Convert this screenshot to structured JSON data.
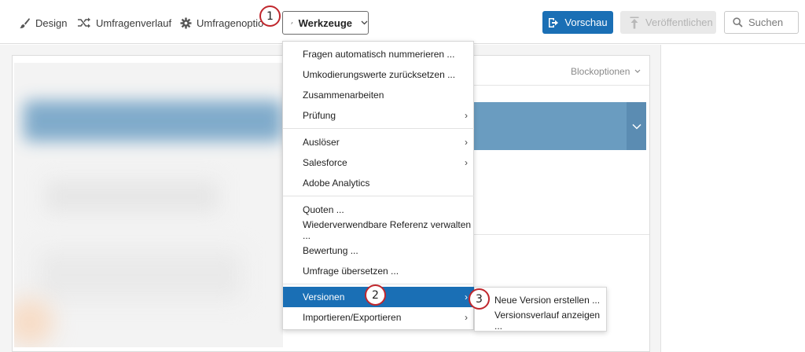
{
  "toolbar": {
    "nav": [
      {
        "label": "Design",
        "icon": "paintbrush-icon"
      },
      {
        "label": "Umfragenverlauf",
        "icon": "flow-icon"
      },
      {
        "label": "Umfragenoptio",
        "icon": "gear-icon"
      }
    ],
    "tools_label": "Werkzeuge",
    "preview_label": "Vorschau",
    "publish_label": "Veröffentlichen",
    "search_label": "Suchen"
  },
  "card": {
    "block_options_label": "Blockoptionen"
  },
  "menu": {
    "items": [
      {
        "label": "Fragen automatisch nummerieren ...",
        "submenu": false
      },
      {
        "label": "Umkodierungswerte zurücksetzen ...",
        "submenu": false
      },
      {
        "label": "Zusammenarbeiten",
        "submenu": false
      },
      {
        "label": "Prüfung",
        "submenu": true
      },
      {
        "label": "Auslöser",
        "submenu": true
      },
      {
        "label": "Salesforce",
        "submenu": true
      },
      {
        "label": "Adobe Analytics",
        "submenu": false
      },
      {
        "label": "Quoten ...",
        "submenu": false
      },
      {
        "label": "Wiederverwendbare Referenz verwalten ...",
        "submenu": false
      },
      {
        "label": "Bewertung ...",
        "submenu": false
      },
      {
        "label": "Umfrage übersetzen ...",
        "submenu": false
      },
      {
        "label": "Versionen",
        "submenu": true,
        "active": true
      },
      {
        "label": "Importieren/Exportieren",
        "submenu": true
      }
    ]
  },
  "submenu": {
    "items": [
      {
        "label": "Neue Version erstellen ..."
      },
      {
        "label": "Versionsverlauf anzeigen ..."
      }
    ]
  },
  "markers": [
    "1",
    "2",
    "3"
  ],
  "colors": {
    "accent": "#1a6fb5",
    "marker_border": "#c0272d",
    "block_bar": "#6a9cc0"
  }
}
